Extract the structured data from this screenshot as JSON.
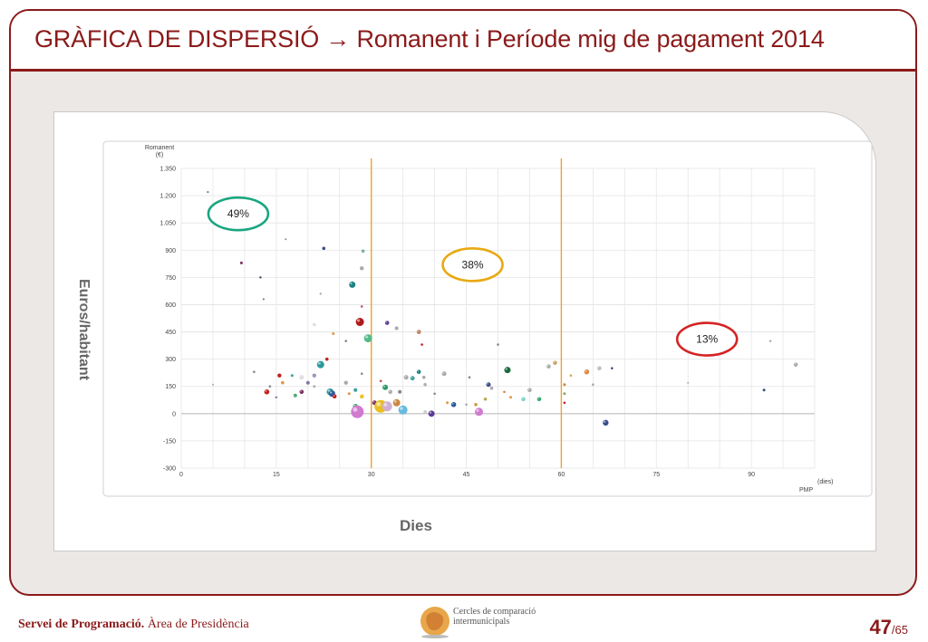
{
  "slide": {
    "title": "GRÀFICA DE DISPERSIÓ → Romanent i Període mig de pagament 2014",
    "footer_bold": "Servei de Programació.",
    "footer_normal": " Àrea de Presidència",
    "logo_line1": "Cercles de comparació",
    "logo_line2": "intermunicipals",
    "page_current": "47",
    "page_total": "/65"
  },
  "colors": {
    "accent": "#8b1a1a",
    "background": "#ece8e6"
  },
  "chart_data": {
    "type": "scatter",
    "outer_xlabel": "Dies",
    "outer_ylabel": "Euros/habitant",
    "ylabel": "Romanent",
    "yunit": "(€)",
    "xlabel": "PMP",
    "xunit": "(dies)",
    "xlim": [
      0,
      100
    ],
    "ylim": [
      -300,
      1350
    ],
    "xticks": [
      0,
      15,
      30,
      45,
      60,
      75,
      90
    ],
    "yticks": [
      -300,
      -150,
      0,
      150,
      300,
      450,
      600,
      750,
      900,
      1050,
      1200,
      1350
    ],
    "ytick_labels": [
      "-300",
      "-150",
      "0",
      "150",
      "300",
      "450",
      "600",
      "750",
      "900",
      "1.050",
      "1.200",
      "1.350"
    ],
    "vlines": [
      30,
      60
    ],
    "grid": true,
    "annotations": [
      {
        "text": "49%",
        "x": 9,
        "y": 1100,
        "color": "#1aa680"
      },
      {
        "text": "38%",
        "x": 46,
        "y": 820,
        "color": "#e8a911"
      },
      {
        "text": "13%",
        "x": 83,
        "y": 410,
        "color": "#d42424"
      }
    ],
    "points": [
      {
        "x": 4.2,
        "y": 1220,
        "c": "#8888aa",
        "r": 1.2
      },
      {
        "x": 9.5,
        "y": 830,
        "c": "#7a2b5b",
        "r": 1.5
      },
      {
        "x": 12.5,
        "y": 750,
        "c": "#444466",
        "r": 1.2
      },
      {
        "x": 13,
        "y": 630,
        "c": "#666688",
        "r": 1
      },
      {
        "x": 16.5,
        "y": 960,
        "c": "#888888",
        "r": 1
      },
      {
        "x": 22.5,
        "y": 910,
        "c": "#3a4f8a",
        "r": 1.8
      },
      {
        "x": 22,
        "y": 660,
        "c": "#aaaaaa",
        "r": 1.2
      },
      {
        "x": 28.7,
        "y": 895,
        "c": "#7ab0a0",
        "r": 1.8
      },
      {
        "x": 28.5,
        "y": 800,
        "c": "#aaaaaa",
        "r": 2.2
      },
      {
        "x": 27,
        "y": 710,
        "c": "#1a8080",
        "r": 3.5
      },
      {
        "x": 28.5,
        "y": 590,
        "c": "#bb5588",
        "r": 1.3
      },
      {
        "x": 28.2,
        "y": 505,
        "c": "#b01a1a",
        "r": 4.5
      },
      {
        "x": 32.5,
        "y": 500,
        "c": "#5a3a9a",
        "r": 2.3
      },
      {
        "x": 34,
        "y": 470,
        "c": "#aaaaaa",
        "r": 2
      },
      {
        "x": 29.5,
        "y": 415,
        "c": "#55bb88",
        "r": 4.5
      },
      {
        "x": 37.5,
        "y": 450,
        "c": "#c08060",
        "r": 2.4
      },
      {
        "x": 21,
        "y": 490,
        "c": "#dddddd",
        "r": 1.8
      },
      {
        "x": 24,
        "y": 440,
        "c": "#dd9944",
        "r": 1.5
      },
      {
        "x": 26,
        "y": 400,
        "c": "#888888",
        "r": 1.3
      },
      {
        "x": 22,
        "y": 270,
        "c": "#2a9a9a",
        "r": 4
      },
      {
        "x": 23,
        "y": 300,
        "c": "#c02020",
        "r": 1.8
      },
      {
        "x": 21,
        "y": 210,
        "c": "#9999bb",
        "r": 2.2
      },
      {
        "x": 20,
        "y": 170,
        "c": "#7a7aaa",
        "r": 2
      },
      {
        "x": 19,
        "y": 200,
        "c": "#dddddd",
        "r": 2.5
      },
      {
        "x": 17.5,
        "y": 210,
        "c": "#3aa0a0",
        "r": 1.5
      },
      {
        "x": 15.5,
        "y": 210,
        "c": "#c02020",
        "r": 2.2
      },
      {
        "x": 14,
        "y": 150,
        "c": "#888888",
        "r": 1.3
      },
      {
        "x": 13.5,
        "y": 120,
        "c": "#c02020",
        "r": 2.8
      },
      {
        "x": 15,
        "y": 90,
        "c": "#8888aa",
        "r": 1.3
      },
      {
        "x": 16,
        "y": 170,
        "c": "#dd9944",
        "r": 1.8
      },
      {
        "x": 18,
        "y": 100,
        "c": "#55aa77",
        "r": 2
      },
      {
        "x": 19,
        "y": 120,
        "c": "#7a2b5b",
        "r": 2.3
      },
      {
        "x": 21,
        "y": 150,
        "c": "#b0b0b0",
        "r": 1.5
      },
      {
        "x": 23.5,
        "y": 120,
        "c": "#2a9a9a",
        "r": 3.8
      },
      {
        "x": 23.8,
        "y": 110,
        "c": "#2a5a9a",
        "r": 3.5
      },
      {
        "x": 24.2,
        "y": 95,
        "c": "#c02020",
        "r": 2.3
      },
      {
        "x": 26,
        "y": 170,
        "c": "#aaaaaa",
        "r": 2.2
      },
      {
        "x": 26.5,
        "y": 110,
        "c": "#dd9944",
        "r": 1.5
      },
      {
        "x": 27.5,
        "y": 130,
        "c": "#3aa0a0",
        "r": 2
      },
      {
        "x": 28.5,
        "y": 220,
        "c": "#888888",
        "r": 1.3
      },
      {
        "x": 28.5,
        "y": 95,
        "c": "#e8c020",
        "r": 2.3
      },
      {
        "x": 27.5,
        "y": 40,
        "c": "#33aa66",
        "r": 2.8
      },
      {
        "x": 27.8,
        "y": 10,
        "c": "#d07ad0",
        "r": 7
      },
      {
        "x": 30.5,
        "y": 60,
        "c": "#7a2b5b",
        "r": 2.5
      },
      {
        "x": 31.5,
        "y": 180,
        "c": "#c05050",
        "r": 1.3
      },
      {
        "x": 32.2,
        "y": 145,
        "c": "#2a9a6a",
        "r": 3
      },
      {
        "x": 33,
        "y": 120,
        "c": "#aaaaaa",
        "r": 2.3
      },
      {
        "x": 31.5,
        "y": 40,
        "c": "#e8c020",
        "r": 7
      },
      {
        "x": 32.5,
        "y": 40,
        "c": "#d0b0d0",
        "r": 5.5
      },
      {
        "x": 34,
        "y": 60,
        "c": "#cc8844",
        "r": 4
      },
      {
        "x": 35,
        "y": 20,
        "c": "#66bbdd",
        "r": 5
      },
      {
        "x": 34.5,
        "y": 120,
        "c": "#888888",
        "r": 2
      },
      {
        "x": 35.5,
        "y": 200,
        "c": "#aaaaaa",
        "r": 2.5
      },
      {
        "x": 36.5,
        "y": 195,
        "c": "#3aa0a0",
        "r": 2.4
      },
      {
        "x": 37.5,
        "y": 230,
        "c": "#1a8080",
        "r": 2.3
      },
      {
        "x": 38,
        "y": 380,
        "c": "#c02020",
        "r": 1.3
      },
      {
        "x": 38.3,
        "y": 200,
        "c": "#aaaaaa",
        "r": 1.8
      },
      {
        "x": 38.5,
        "y": 160,
        "c": "#b0b0b0",
        "r": 1.8
      },
      {
        "x": 38.5,
        "y": 10,
        "c": "#cccccc",
        "r": 1.8
      },
      {
        "x": 39.5,
        "y": 0,
        "c": "#5a3a9a",
        "r": 3.5
      },
      {
        "x": 40,
        "y": 110,
        "c": "#888888",
        "r": 1.3
      },
      {
        "x": 41.5,
        "y": 220,
        "c": "#aaaaaa",
        "r": 2.5
      },
      {
        "x": 42,
        "y": 60,
        "c": "#dd9944",
        "r": 1.5
      },
      {
        "x": 43,
        "y": 50,
        "c": "#2a5a9a",
        "r": 2.8
      },
      {
        "x": 45,
        "y": 50,
        "c": "#aaaaaa",
        "r": 1.3
      },
      {
        "x": 45.5,
        "y": 200,
        "c": "#888888",
        "r": 1.3
      },
      {
        "x": 46.5,
        "y": 50,
        "c": "#cc9944",
        "r": 1.8
      },
      {
        "x": 47,
        "y": 10,
        "c": "#d07ad0",
        "r": 4.5
      },
      {
        "x": 48,
        "y": 80,
        "c": "#bbaa55",
        "r": 1.8
      },
      {
        "x": 48.5,
        "y": 160,
        "c": "#3a4f8a",
        "r": 2.5
      },
      {
        "x": 49,
        "y": 140,
        "c": "#aaaaaa",
        "r": 1.8
      },
      {
        "x": 50,
        "y": 380,
        "c": "#888888",
        "r": 1.3
      },
      {
        "x": 51.5,
        "y": 240,
        "c": "#1a6a3a",
        "r": 3.5
      },
      {
        "x": 51,
        "y": 120,
        "c": "#cc8844",
        "r": 1.3
      },
      {
        "x": 52,
        "y": 90,
        "c": "#dd9944",
        "r": 1.5
      },
      {
        "x": 54,
        "y": 80,
        "c": "#7ad0d0",
        "r": 2.3
      },
      {
        "x": 55,
        "y": 130,
        "c": "#aaaaaa",
        "r": 2.3
      },
      {
        "x": 56.5,
        "y": 80,
        "c": "#33aa66",
        "r": 2.3
      },
      {
        "x": 58,
        "y": 260,
        "c": "#aaaaaa",
        "r": 2.3
      },
      {
        "x": 59,
        "y": 280,
        "c": "#d0a060",
        "r": 2.3
      },
      {
        "x": 60.5,
        "y": 160,
        "c": "#cc8844",
        "r": 1.5
      },
      {
        "x": 60.5,
        "y": 110,
        "c": "#88aa66",
        "r": 1.5
      },
      {
        "x": 60.5,
        "y": 60,
        "c": "#c02020",
        "r": 1.3
      },
      {
        "x": 61.5,
        "y": 210,
        "c": "#ccaa55",
        "r": 1.3
      },
      {
        "x": 64,
        "y": 230,
        "c": "#dd8844",
        "r": 2.8
      },
      {
        "x": 65,
        "y": 160,
        "c": "#aaaaaa",
        "r": 1.3
      },
      {
        "x": 66,
        "y": 250,
        "c": "#bbbbbb",
        "r": 2.3
      },
      {
        "x": 67,
        "y": -50,
        "c": "#3a4f8a",
        "r": 3.2
      },
      {
        "x": 68,
        "y": 250,
        "c": "#3a4f8a",
        "r": 1.3
      },
      {
        "x": 80,
        "y": 170,
        "c": "#aaaaaa",
        "r": 1
      },
      {
        "x": 92,
        "y": 130,
        "c": "#3a4f8a",
        "r": 1.5
      },
      {
        "x": 93,
        "y": 400,
        "c": "#888888",
        "r": 1
      },
      {
        "x": 97,
        "y": 270,
        "c": "#aaaaaa",
        "r": 2.3
      },
      {
        "x": 5,
        "y": 160,
        "c": "#aaaaaa",
        "r": 1
      },
      {
        "x": 11.5,
        "y": 230,
        "c": "#888888",
        "r": 1.3
      }
    ]
  }
}
